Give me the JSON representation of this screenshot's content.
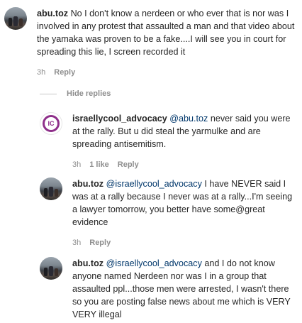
{
  "comments": [
    {
      "username": "abu.toz",
      "mention": "",
      "text": "No I don't know a nerdeen or who ever that is nor was I involved in any protest that assaulted a man and that video about the yamaka was proven to be a fake....I will see you in court for spreading this lie, I screen recorded it",
      "time": "3h",
      "likes": "",
      "reply": "Reply"
    },
    {
      "username": "israellycool_advocacy",
      "mention": "@abu.toz",
      "text": "never said you were at the rally. But u did steal the yarmulke and are spreading antisemitism.",
      "time": "3h",
      "likes": "1 like",
      "reply": "Reply"
    },
    {
      "username": "abu.toz",
      "mention": "@israellycool_advocacy",
      "text": "I have NEVER said I was at a rally because I never was at a rally...I'm seeing a lawyer tomorrow, you better have some@great evidence",
      "time": "3h",
      "likes": "",
      "reply": "Reply"
    },
    {
      "username": "abu.toz",
      "mention": "@israellycool_advocacy",
      "text": "and I do not know anyone named Nerdeen nor was I in a group that assaulted ppl...those men were arrested, I wasn't there so you are posting false news about me which is VERY VERY illegal",
      "time": "",
      "likes": "",
      "reply": ""
    }
  ],
  "hide_replies_label": "Hide replies",
  "logo_letters": "IC",
  "colors": {
    "mention": "#00376b",
    "meta": "#8e8e8e",
    "logo": "#8e2f8a"
  }
}
